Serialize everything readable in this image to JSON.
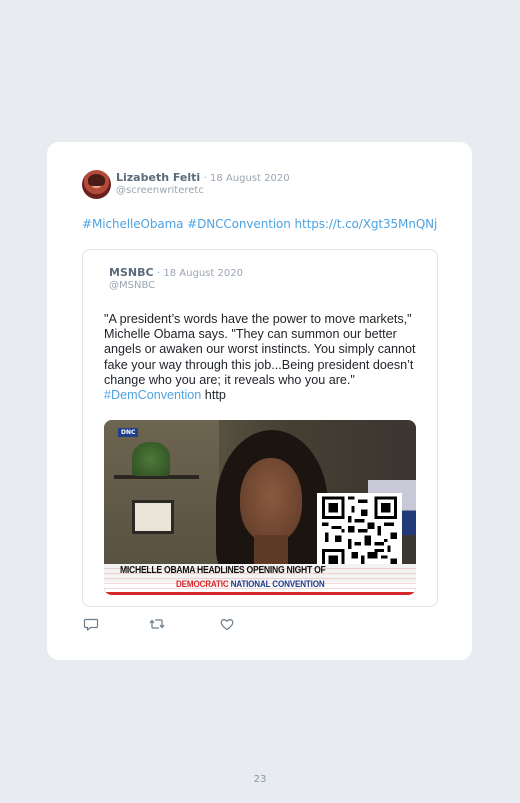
{
  "tweet": {
    "author_name": "Lizabeth Felti",
    "date": "· 18 August 2020",
    "handle": "@screenwriteretc",
    "hashtags": [
      "#MichelleObama",
      "#DNCConvention"
    ],
    "link": "https://t.co/Xgt35MnQNj"
  },
  "quoted": {
    "author_name": "MSNBC",
    "date": "· 18 August 2020",
    "handle": "@MSNBC",
    "text": "\"A president’s words have the power to move markets,\" Michelle Obama says. \"They can summon our better angels or awaken our worst instincts. You simply cannot fake your way through this job...Being president doesn’t change who you are; it reveals who you are.\" ",
    "hashtag": "#DemConvention",
    "text_tail": " http",
    "media": {
      "badge": "DNC",
      "headline": "MICHELLE OBAMA HEADLINES OPENING NIGHT OF",
      "subline_red": "DEMOCRATIC",
      "subline_blue": "NATIONAL CONVENTION"
    }
  },
  "actions": {
    "reply_icon": "reply-icon",
    "retweet_icon": "retweet-icon",
    "like_icon": "heart-icon"
  },
  "page_number": "23",
  "colors": {
    "background": "#e8ebef",
    "card": "#ffffff",
    "link": "#4fa3e0",
    "muted": "#9aa5b1"
  }
}
